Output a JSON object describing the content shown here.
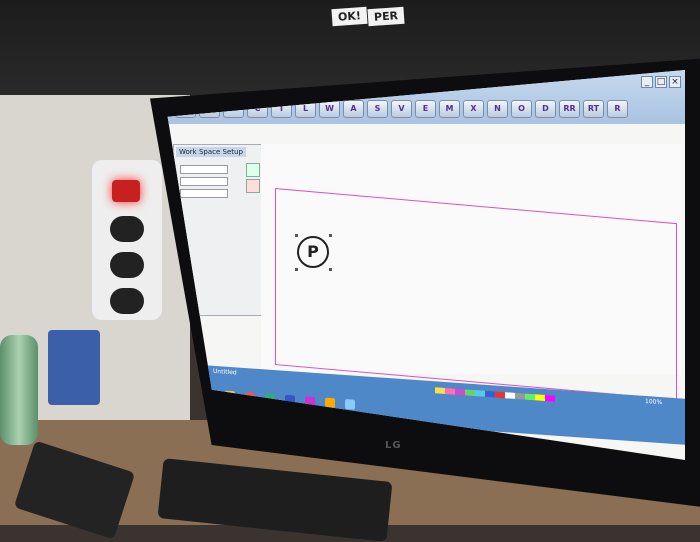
{
  "photo": {
    "shelf_labels": [
      "OK!",
      "PER"
    ]
  },
  "monitor": {
    "brand": "LG"
  },
  "app": {
    "window_controls": [
      "_",
      "□",
      "×"
    ],
    "toolbar_labels": [
      "P",
      "R",
      "B",
      "C",
      "T",
      "L",
      "W",
      "A",
      "S",
      "V",
      "E",
      "M",
      "X",
      "N",
      "O",
      "D",
      "RR",
      "RT",
      "R"
    ],
    "panel": {
      "title": "Work Space Setup"
    },
    "canvas": {
      "symbol_glyph": "P"
    },
    "taskbar": {
      "palette_colors": [
        "#f4e04d",
        "#ff6fb5",
        "#d04ad0",
        "#6ad06a",
        "#58c7ec",
        "#3860d0",
        "#e33",
        "#fff",
        "#999",
        "#6e6",
        "#ff0",
        "#f0f"
      ],
      "status_left": "Untitled",
      "status_right": "100%"
    }
  }
}
